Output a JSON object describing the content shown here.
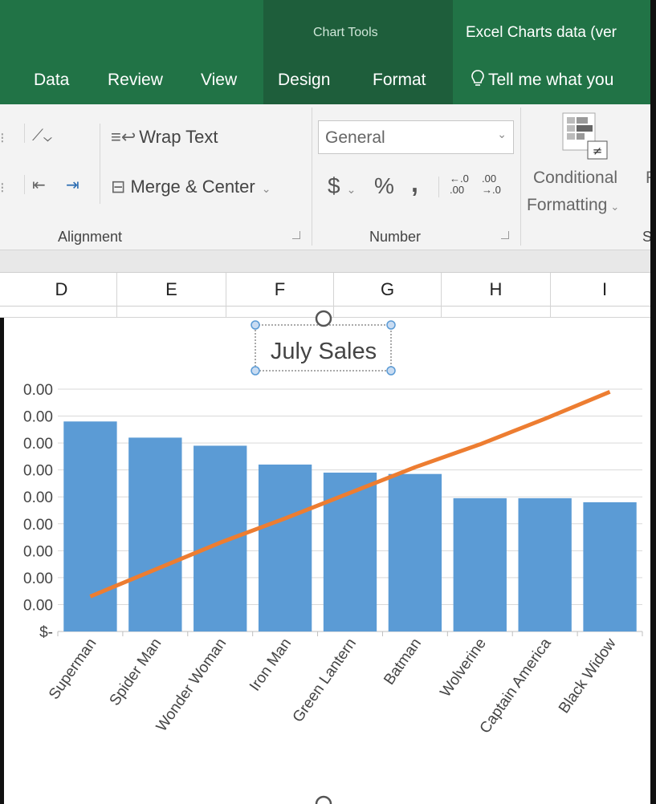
{
  "titlebar": {
    "chart_tools": "Chart Tools",
    "doc_title": "Excel Charts data (ver"
  },
  "tabs": [
    {
      "label": "Data"
    },
    {
      "label": "Review"
    },
    {
      "label": "View"
    },
    {
      "label": "Design"
    },
    {
      "label": "Format"
    }
  ],
  "tell_me": "Tell me what you",
  "ribbon": {
    "wrap_text": "Wrap Text",
    "merge_center": "Merge & Center",
    "number_format": "General",
    "currency": "$",
    "percent": "%",
    "comma": ",",
    "conditional": "Conditional",
    "formatting": "Formatting",
    "alignment_group": "Alignment",
    "number_group": "Number",
    "next_group_fragment": "S",
    "next_button_fragment": "F"
  },
  "columns": [
    "D",
    "E",
    "F",
    "G",
    "H",
    "I"
  ],
  "chart_data": {
    "type": "bar",
    "title": "July Sales",
    "categories": [
      "Superman",
      "Spider Man",
      "Wonder Woman",
      "Iron Man",
      "Green Lantern",
      "Batman",
      "Wolverine",
      "Captain America",
      "Black Widow"
    ],
    "series": [
      {
        "type": "bar",
        "values": [
          7.8,
          7.2,
          6.9,
          6.2,
          5.9,
          5.85,
          4.95,
          4.95,
          4.8
        ],
        "color": "#5b9bd5"
      },
      {
        "type": "line",
        "values": [
          1.3,
          2.3,
          3.3,
          4.2,
          5.15,
          6.1,
          6.95,
          7.9,
          8.9
        ],
        "color": "#ed7d31"
      }
    ],
    "ylim": [
      0,
      9
    ],
    "y_tick_labels": [
      "$-",
      "0.00",
      "0.00",
      "0.00",
      "0.00",
      "0.00",
      "0.00",
      "0.00",
      "0.00",
      "0.00"
    ],
    "grid": true
  }
}
